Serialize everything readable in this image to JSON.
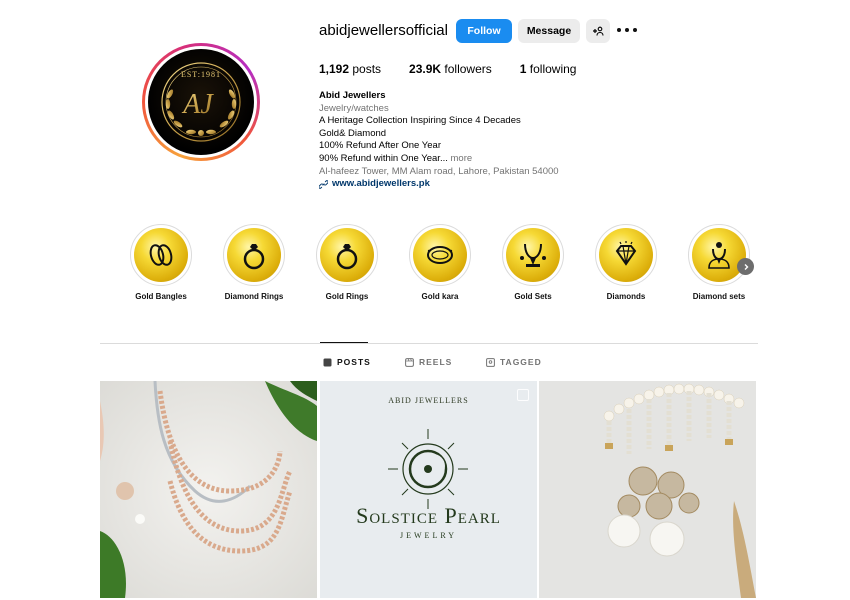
{
  "profile": {
    "username": "abidjewellersofficial",
    "follow_label": "Follow",
    "message_label": "Message",
    "avatar_text_top": "EST:1981",
    "avatar_monogram": "AJ"
  },
  "stats": {
    "posts_count": "1,192",
    "posts_label": " posts",
    "followers_count": "23.9K",
    "followers_label": " followers",
    "following_count": "1",
    "following_label": " following"
  },
  "bio": {
    "name": "Abid Jewellers",
    "category": "Jewelry/watches",
    "line1": "A Heritage Collection Inspiring Since 4 Decades",
    "line2": "Gold& Diamond",
    "line3": "100% Refund After One Year",
    "line4": "90% Refund within One Year...",
    "more": " more",
    "address": "Al-hafeez Tower, MM Alam road, Lahore, Pakistan 54000",
    "website": "www.abidjewellers.pk"
  },
  "highlights": [
    {
      "label": "Gold Bangles",
      "icon": "bangles-icon"
    },
    {
      "label": "Diamond Rings",
      "icon": "diamond-ring-icon"
    },
    {
      "label": "Gold Rings",
      "icon": "ring-icon"
    },
    {
      "label": "Gold kara",
      "icon": "kara-icon"
    },
    {
      "label": "Gold Sets",
      "icon": "necklace-set-icon"
    },
    {
      "label": "Diamonds",
      "icon": "diamond-icon"
    },
    {
      "label": "Diamond sets",
      "icon": "necklace-bust-icon"
    }
  ],
  "tabs": [
    {
      "label": "POSTS",
      "icon": "grid-icon",
      "active": true
    },
    {
      "label": "REELS",
      "icon": "reels-icon",
      "active": false
    },
    {
      "label": "TAGGED",
      "icon": "tagged-icon",
      "active": false
    }
  ],
  "posts": {
    "post2_brand_small": "ABID JEWELLERS",
    "post2_title": "Solstice Pearl",
    "post2_subtitle": "JEWELRY"
  },
  "colors": {
    "follow_button": "#1a8cf0",
    "link": "#00376b",
    "highlight_gold": "#dcae0a",
    "brand_green": "#243a1d"
  }
}
